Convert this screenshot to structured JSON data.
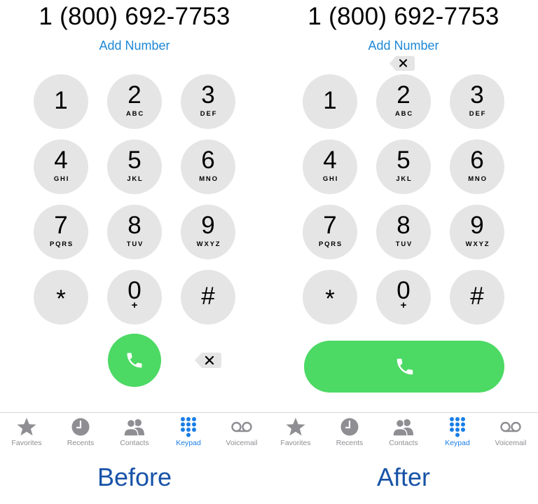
{
  "before": {
    "phone_number": "1 (800) 692-7753",
    "add_number": "Add Number",
    "caption": "Before"
  },
  "after": {
    "phone_number": "1 (800) 692-7753",
    "add_number": "Add Number",
    "caption": "After"
  },
  "keys": [
    {
      "digit": "1",
      "letters": ""
    },
    {
      "digit": "2",
      "letters": "ABC"
    },
    {
      "digit": "3",
      "letters": "DEF"
    },
    {
      "digit": "4",
      "letters": "GHI"
    },
    {
      "digit": "5",
      "letters": "JKL"
    },
    {
      "digit": "6",
      "letters": "MNO"
    },
    {
      "digit": "7",
      "letters": "PQRS"
    },
    {
      "digit": "8",
      "letters": "TUV"
    },
    {
      "digit": "9",
      "letters": "WXYZ"
    },
    {
      "digit": "*",
      "letters": ""
    },
    {
      "digit": "0",
      "letters": "+"
    },
    {
      "digit": "#",
      "letters": ""
    }
  ],
  "tabs": [
    {
      "label": "Favorites",
      "icon": "star-icon",
      "active": false
    },
    {
      "label": "Recents",
      "icon": "clock-icon",
      "active": false
    },
    {
      "label": "Contacts",
      "icon": "contacts-icon",
      "active": false
    },
    {
      "label": "Keypad",
      "icon": "keypad-icon",
      "active": true
    },
    {
      "label": "Voicemail",
      "icon": "voicemail-icon",
      "active": false
    }
  ],
  "colors": {
    "call_green": "#4cd964",
    "key_gray": "#e5e5e5",
    "link_blue": "#1f88d6",
    "tab_active": "#1a7ee6",
    "tab_inactive": "#8e8e93",
    "caption_blue": "#1853a8"
  }
}
